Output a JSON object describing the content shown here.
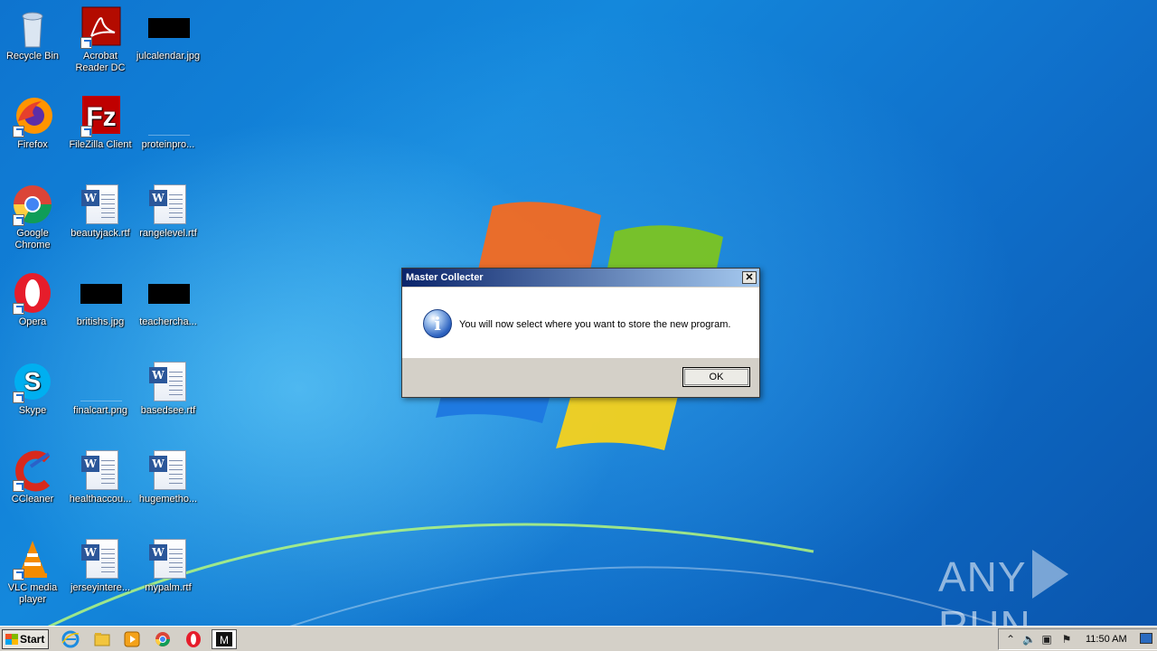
{
  "desktop": {
    "icons": [
      {
        "label": "Recycle Bin",
        "icon": "recycle-bin-icon"
      },
      {
        "label": "Acrobat Reader DC",
        "icon": "acrobat-reader-icon"
      },
      {
        "label": "julcalendar.jpg",
        "icon": "image-file-icon"
      },
      {
        "label": "Firefox",
        "icon": "firefox-icon"
      },
      {
        "label": "FileZilla Client",
        "icon": "filezilla-icon"
      },
      {
        "label": "proteinpro...",
        "icon": "image-file-icon"
      },
      {
        "label": "Google Chrome",
        "icon": "chrome-icon"
      },
      {
        "label": "beautyjack.rtf",
        "icon": "word-document-icon"
      },
      {
        "label": "rangelevel.rtf",
        "icon": "word-document-icon"
      },
      {
        "label": "Opera",
        "icon": "opera-icon"
      },
      {
        "label": "britishs.jpg",
        "icon": "image-file-icon"
      },
      {
        "label": "teachercha...",
        "icon": "image-file-icon"
      },
      {
        "label": "Skype",
        "icon": "skype-icon"
      },
      {
        "label": "finalcart.png",
        "icon": "image-file-icon"
      },
      {
        "label": "basedsee.rtf",
        "icon": "word-document-icon"
      },
      {
        "label": "CCleaner",
        "icon": "ccleaner-icon"
      },
      {
        "label": "healthaccou...",
        "icon": "word-document-icon"
      },
      {
        "label": "hugemetho...",
        "icon": "word-document-icon"
      },
      {
        "label": "VLC media player",
        "icon": "vlc-icon"
      },
      {
        "label": "jerseyintere...",
        "icon": "word-document-icon"
      },
      {
        "label": "mypalm.rtf",
        "icon": "word-document-icon"
      }
    ]
  },
  "dialog": {
    "title": "Master Collecter",
    "close_label": "✕",
    "message": "You will now select where you want to store the new program.",
    "ok_label": "OK",
    "icon": "information-icon"
  },
  "watermark": {
    "left": "ANY",
    "right": "RUN"
  },
  "taskbar": {
    "start_label": "Start",
    "pinned": [
      "internet-explorer-icon",
      "file-explorer-icon",
      "media-player-icon",
      "chrome-icon",
      "opera-icon",
      "master-collecter-icon"
    ],
    "tray": {
      "icons": [
        "show-hidden-icons-arrow",
        "volume-icon",
        "network-icon",
        "action-center-flag-icon"
      ],
      "clock": "11:50 AM"
    }
  },
  "colors": {
    "desktop_blue": "#0b6cc4",
    "dialog_title_start": "#0a246a",
    "dialog_title_end": "#a6caf0",
    "taskbar": "#d4d0c8"
  }
}
